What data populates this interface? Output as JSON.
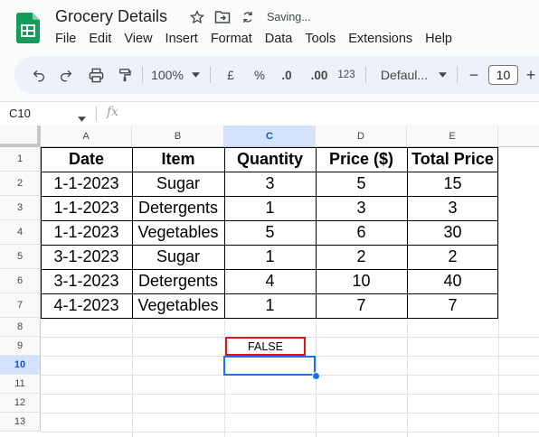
{
  "app": {
    "title": "Grocery Details",
    "status": "Saving...",
    "icons": [
      "star-icon",
      "move-to-folder-icon",
      "sync-icon"
    ]
  },
  "menu": [
    "File",
    "Edit",
    "View",
    "Insert",
    "Format",
    "Data",
    "Tools",
    "Extensions",
    "Help"
  ],
  "toolbar": {
    "zoom": "100%",
    "currency": "£",
    "percent": "%",
    "decrease_decimal": ".0",
    "increase_decimal": ".00",
    "number_format": "123",
    "font": "Defaul...",
    "minus": "−",
    "font_size": "10",
    "plus": "+"
  },
  "formula_bar": {
    "name_box": "C10",
    "fx": "fx"
  },
  "columns": [
    "A",
    "B",
    "C",
    "D",
    "E"
  ],
  "selected_column": "C",
  "rows": [
    "1",
    "2",
    "3",
    "4",
    "5",
    "6",
    "7",
    "8",
    "9",
    "10",
    "11",
    "12",
    "13"
  ],
  "selected_row": "10",
  "table": {
    "headers": [
      "Date",
      "Item",
      "Quantity",
      "Price ($)",
      "Total Price"
    ],
    "rows": [
      [
        "1-1-2023",
        "Sugar",
        "3",
        "5",
        "15"
      ],
      [
        "1-1-2023",
        "Detergents",
        "1",
        "3",
        "3"
      ],
      [
        "1-1-2023",
        "Vegetables",
        "5",
        "6",
        "30"
      ],
      [
        "3-1-2023",
        "Sugar",
        "1",
        "2",
        "2"
      ],
      [
        "3-1-2023",
        "Detergents",
        "4",
        "10",
        "40"
      ],
      [
        "4-1-2023",
        "Vegetables",
        "1",
        "7",
        "7"
      ]
    ]
  },
  "result_cell": {
    "address": "C9",
    "value": "FALSE",
    "highlight_color": "#e0121b"
  },
  "colors": {
    "accent": "#1a73e8",
    "selected_header": "#d3e3fd",
    "logo_green": "#0f9d58"
  }
}
